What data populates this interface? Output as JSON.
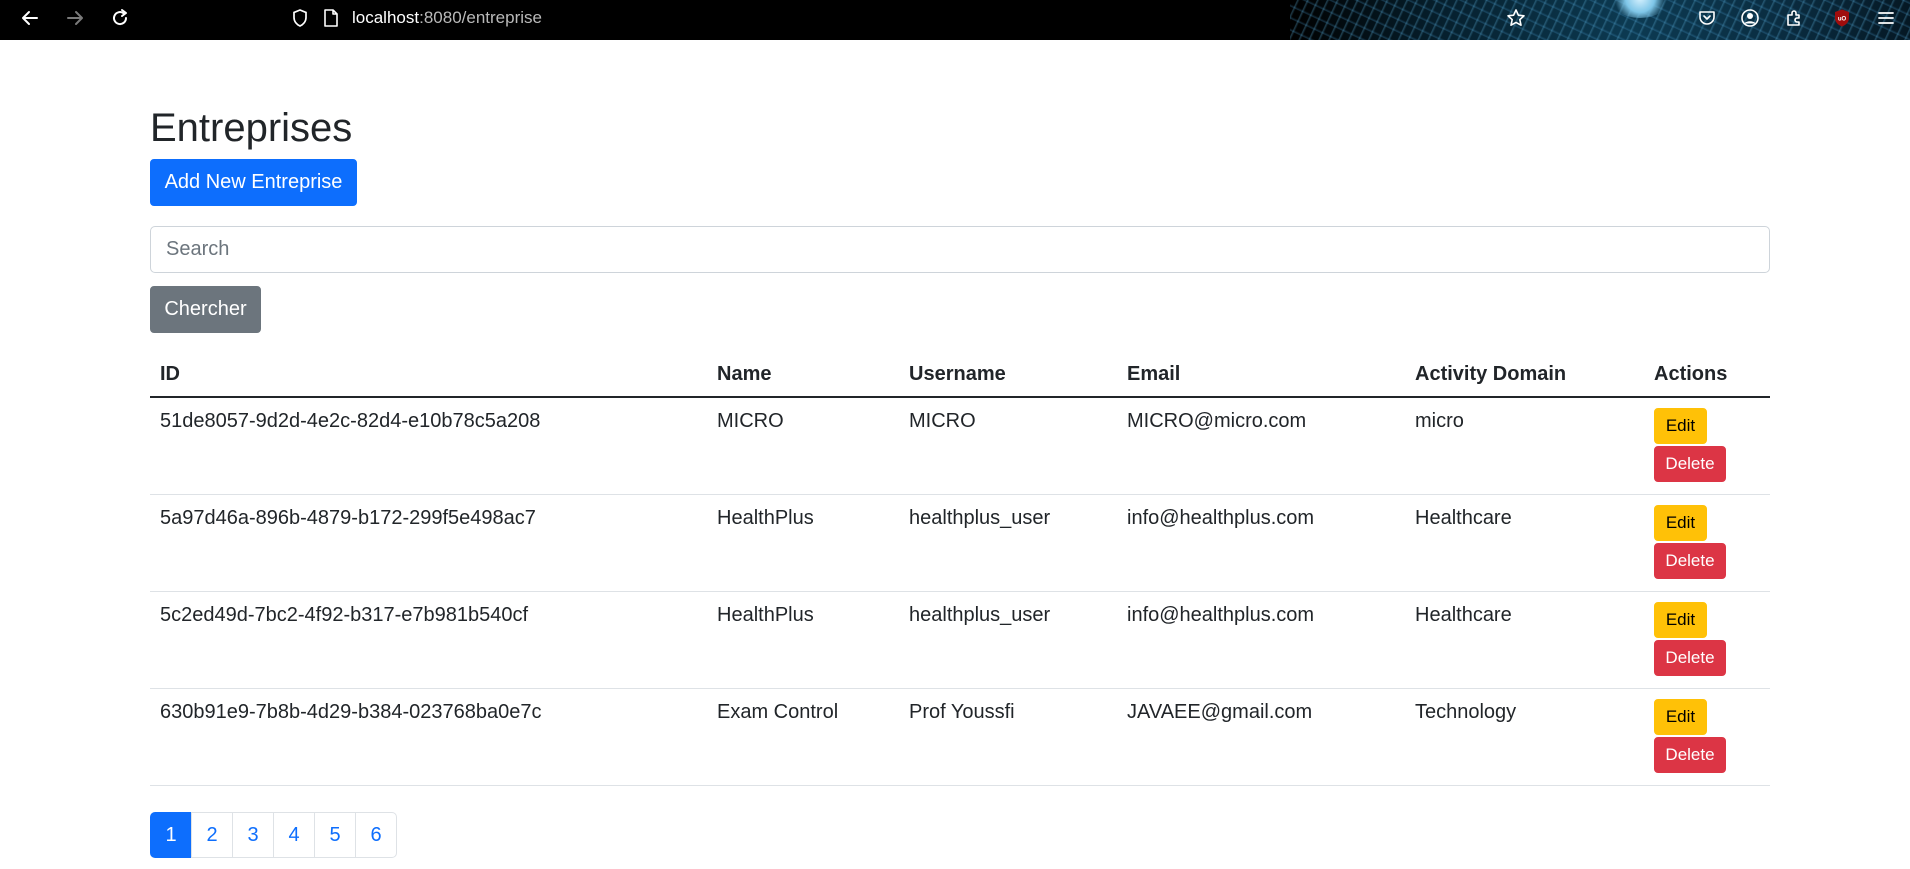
{
  "browser": {
    "url_host": "localhost",
    "url_rest": ":8080/entreprise"
  },
  "page": {
    "title": "Entreprises",
    "add_button_label": "Add New Entreprise",
    "search_placeholder": "Search",
    "search_button_label": "Chercher"
  },
  "table": {
    "headers": {
      "id": "ID",
      "name": "Name",
      "username": "Username",
      "email": "Email",
      "domain": "Activity Domain",
      "actions": "Actions"
    },
    "edit_label": "Edit",
    "delete_label": "Delete",
    "rows": [
      {
        "id": "51de8057-9d2d-4e2c-82d4-e10b78c5a208",
        "name": "MICRO",
        "username": "MICRO",
        "email": "MICRO@micro.com",
        "domain": "micro"
      },
      {
        "id": "5a97d46a-896b-4879-b172-299f5e498ac7",
        "name": "HealthPlus",
        "username": "healthplus_user",
        "email": "info@healthplus.com",
        "domain": "Healthcare"
      },
      {
        "id": "5c2ed49d-7bc2-4f92-b317-e7b981b540cf",
        "name": "HealthPlus",
        "username": "healthplus_user",
        "email": "info@healthplus.com",
        "domain": "Healthcare"
      },
      {
        "id": "630b91e9-7b8b-4d29-b384-023768ba0e7c",
        "name": "Exam Control",
        "username": "Prof Youssfi",
        "email": "JAVAEE@gmail.com",
        "domain": "Technology"
      }
    ]
  },
  "pagination": {
    "pages": [
      "1",
      "2",
      "3",
      "4",
      "5",
      "6"
    ],
    "active": "1"
  },
  "colors": {
    "primary": "#0d6efd",
    "secondary": "#6c757d",
    "warning": "#ffc107",
    "danger": "#dc3545"
  },
  "icons": {
    "toolbar": [
      "back-arrow-icon",
      "forward-arrow-icon",
      "reload-icon",
      "shield-icon",
      "page-icon",
      "star-icon",
      "pocket-icon",
      "account-icon",
      "extensions-icon",
      "ublock-icon",
      "menu-icon"
    ]
  }
}
